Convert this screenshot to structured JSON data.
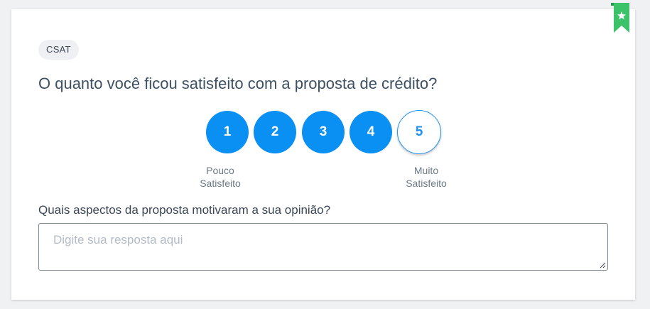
{
  "badge": "CSAT",
  "question": "O quanto você ficou satisfeito com a proposta de crédito?",
  "rating": {
    "options": [
      "1",
      "2",
      "3",
      "4",
      "5"
    ],
    "low_label_line1": "Pouco",
    "low_label_line2": "Satisfeito",
    "high_label_line1": "Muito",
    "high_label_line2": "Satisfeito"
  },
  "comment": {
    "label": "Quais aspectos da proposta motivaram a sua opinião?",
    "placeholder": "Digite sua resposta aqui",
    "value": ""
  },
  "colors": {
    "accent": "#0a8ff3",
    "bookmark": "#3cc36a",
    "text": "#3e5064"
  },
  "icons": {
    "bookmark": "bookmark-star-icon",
    "resize": "resize-grip-icon"
  }
}
